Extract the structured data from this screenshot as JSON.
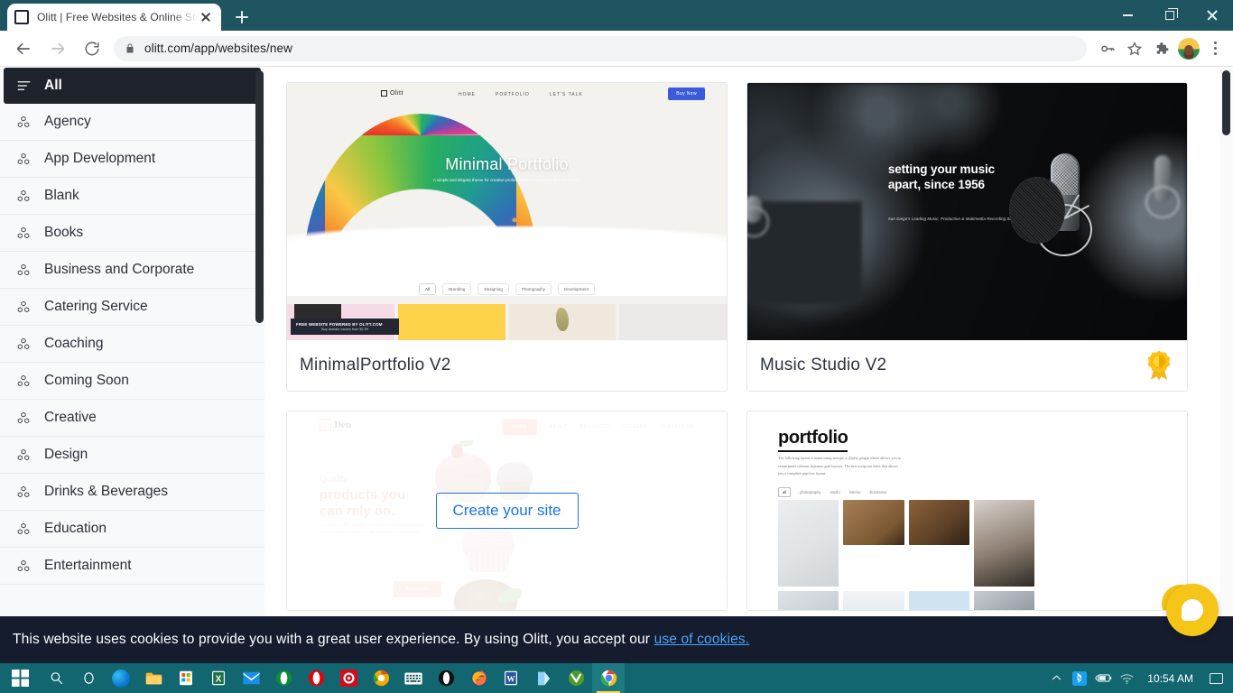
{
  "browser": {
    "tab": {
      "title": "Olitt | Free Websites & Online Sto",
      "favicon": "square-favicon-icon",
      "close": "close-icon"
    },
    "new_tab_label": "+",
    "window_controls": {
      "minimize": "minimize-icon",
      "maximize": "restore-icon",
      "close": "close-icon"
    },
    "nav": {
      "back": "back-arrow-icon",
      "forward": "forward-arrow-icon",
      "reload": "reload-icon"
    },
    "omnibox": {
      "url": "olitt.com/app/websites/new",
      "lock": "lock-icon"
    },
    "toolbar_icons": [
      "key-icon",
      "star-bookmark-icon",
      "puzzle-extensions-icon",
      "profile-avatar",
      "three-dot-menu-icon"
    ]
  },
  "sidebar": {
    "items": [
      {
        "label": "All",
        "icon": "list-lines-icon",
        "active": true
      },
      {
        "label": "Agency",
        "icon": "cubes-icon",
        "active": false
      },
      {
        "label": "App Development",
        "icon": "cubes-icon",
        "active": false
      },
      {
        "label": "Blank",
        "icon": "cubes-icon",
        "active": false
      },
      {
        "label": "Books",
        "icon": "cubes-icon",
        "active": false
      },
      {
        "label": "Business and Corporate",
        "icon": "cubes-icon",
        "active": false
      },
      {
        "label": "Catering Service",
        "icon": "cubes-icon",
        "active": false
      },
      {
        "label": "Coaching",
        "icon": "cubes-icon",
        "active": false
      },
      {
        "label": "Coming Soon",
        "icon": "cubes-icon",
        "active": false
      },
      {
        "label": "Creative",
        "icon": "cubes-icon",
        "active": false
      },
      {
        "label": "Design",
        "icon": "cubes-icon",
        "active": false
      },
      {
        "label": "Drinks & Beverages",
        "icon": "cubes-icon",
        "active": false
      },
      {
        "label": "Education",
        "icon": "cubes-icon",
        "active": false
      },
      {
        "label": "Entertainment",
        "icon": "cubes-icon",
        "active": false
      }
    ]
  },
  "templates": [
    {
      "title": "MinimalPortfolio V2",
      "premium": false,
      "hovered": false,
      "preview": {
        "logo": "Olitt",
        "nav": [
          "HOME",
          "PORTFOLIO",
          "LET'S TALK"
        ],
        "cta": "Buy Now",
        "hero_title": "Minimal Portfolio",
        "hero_sub": "A simple and elegant theme for creative professionals showcasing their best work.",
        "filters": [
          "All",
          "Branding",
          "Designing",
          "Photography",
          "Development"
        ],
        "banner_title": "FREE WEBSITE POWERED BY OLITT.COM",
        "banner_sub": "Buy domain names from $2.99"
      }
    },
    {
      "title": "Music Studio V2",
      "premium": true,
      "premium_badge": "award-badge-icon",
      "hovered": false,
      "preview": {
        "hero_title_line1": "setting your music",
        "hero_title_line2": "apart, since 1956",
        "hero_sub": "San Diego's Leading Music, Production & Multimedia Recording Studio"
      }
    },
    {
      "title": "",
      "premium": false,
      "hovered": true,
      "hover_button": "Create your site",
      "preview": {
        "logo": "Den",
        "nav": [
          "HOME",
          "ABOUT",
          "PRODUCTS",
          "GALLERY",
          "CONTACT US"
        ],
        "heading_small": "Quality",
        "heading_line1": "products you",
        "heading_line2": "can rely on.",
        "body": "Lorem ipsum dolor sit amet, consectetur adipisicing elit, sed do eiusmod tempor incididunt ut labore et dolore magna aliqua.",
        "cta": "Read More"
      }
    },
    {
      "title": "",
      "premium": false,
      "hovered": false,
      "preview": {
        "heading": "portfolio",
        "body": "The following layout is made using isotope, a jQuery plugin which allows you to create multi-column, dynamic grid layouts. The first script out there that allows you a complete gap-free layout.",
        "filters": [
          "all",
          "photography",
          "studio",
          "interior",
          "illustration"
        ]
      }
    }
  ],
  "cookie_notice": {
    "text": "This website uses cookies to provide you with a great user experience. By using Olitt, you accept our ",
    "link": "use of cookies."
  },
  "chat_widget": {
    "icon": "chat-bubble-icon"
  },
  "taskbar": {
    "start": "windows-start-icon",
    "apps": [
      "search-icon",
      "cortana-icon",
      "edge-icon",
      "file-explorer-icon",
      "microsoft-store-icon",
      "excel-icon",
      "mail-icon",
      "opera-gx-icon",
      "opera-icon",
      "target-app-icon",
      "chrome-canary-icon",
      "touch-keyboard-icon",
      "dark-browser-icon",
      "firefox-icon",
      "word-icon",
      "onedrive-icon",
      "vivaldi-icon",
      "chrome-icon"
    ],
    "tray": [
      "chevron-up-icon",
      "bluetooth-icon",
      "battery-icon",
      "wifi-icon"
    ],
    "clock": "10:54 AM",
    "action_center": "action-center-icon"
  },
  "colors": {
    "titlebar_teal": "#1f5560",
    "taskbar_teal": "#11666f",
    "cookie_bar": "#151c2e",
    "sidebar_active": "#1e222b",
    "accent_blue": "#1a73e8",
    "chat_yellow": "#f5c518",
    "link_blue": "#4da3ff"
  }
}
